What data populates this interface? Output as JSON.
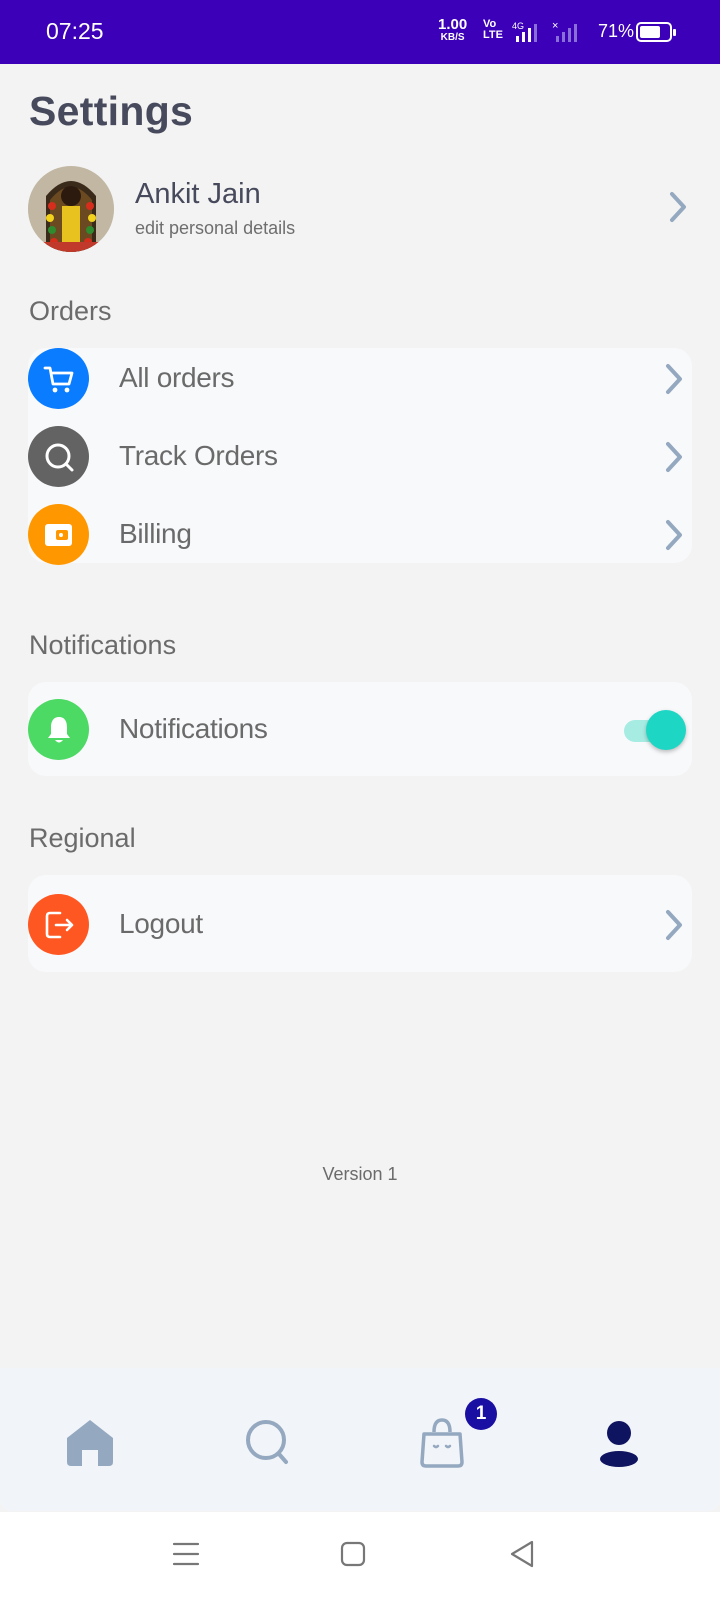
{
  "status_bar": {
    "time": "07:25",
    "net_speed": "1.00",
    "net_unit": "KB/S",
    "volte_top": "Vo",
    "volte_bottom": "LTE",
    "network_type": "4G",
    "battery_percent": "71%",
    "battery_level": 0.71,
    "colors": {
      "background": "#3b00b7"
    }
  },
  "header": {
    "title": "Settings"
  },
  "profile": {
    "name": "Ankit Jain",
    "subtitle": "edit personal details"
  },
  "sections": {
    "orders": {
      "label": "Orders",
      "items": [
        {
          "label": "All orders",
          "icon": "cart-icon",
          "color": "#0a7cff"
        },
        {
          "label": "Track Orders",
          "icon": "search-icon",
          "color": "#636363"
        },
        {
          "label": "Billing",
          "icon": "wallet-icon",
          "color": "#ff9800"
        }
      ]
    },
    "notifications": {
      "label": "Notifications",
      "items": [
        {
          "label": "Notifications",
          "icon": "bell-icon",
          "color": "#4cd964",
          "enabled": true
        }
      ]
    },
    "regional": {
      "label": "Regional",
      "items": [
        {
          "label": "Logout",
          "icon": "logout-icon",
          "color": "#ff5722"
        }
      ]
    }
  },
  "footer": {
    "version": "Version 1"
  },
  "bottom_nav": {
    "items": [
      {
        "name": "home",
        "icon": "home-icon"
      },
      {
        "name": "search",
        "icon": "search-icon"
      },
      {
        "name": "cart",
        "icon": "shopping-bag-icon"
      },
      {
        "name": "profile",
        "icon": "user-icon",
        "active": true
      }
    ],
    "cart_badge": "1",
    "colors": {
      "inactive": "#94a8c0",
      "active": "#0f1460",
      "badge": "#1a0fa3"
    }
  },
  "system_nav": {
    "items": [
      {
        "icon": "menu-icon"
      },
      {
        "icon": "home-square-icon"
      },
      {
        "icon": "back-icon"
      }
    ]
  }
}
